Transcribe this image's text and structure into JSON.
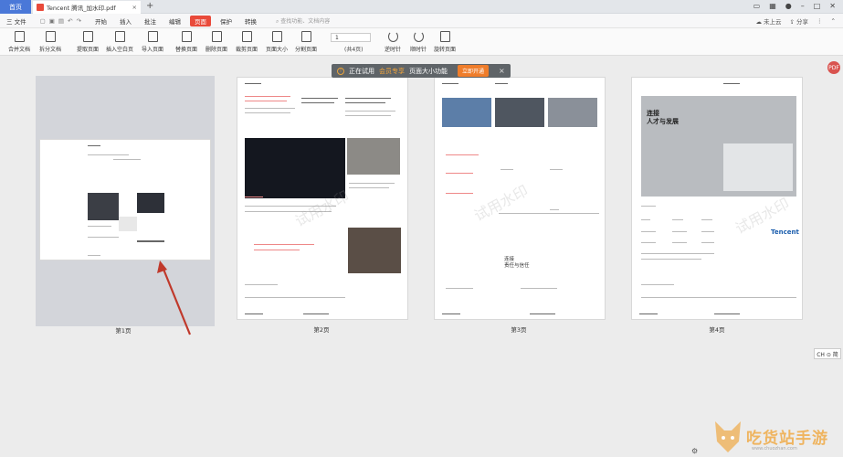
{
  "tabbar": {
    "home_label": "首页",
    "doc_title": "Tencent 腾讯_加水印.pdf",
    "close_glyph": "×",
    "new_tab_glyph": "+"
  },
  "menubar": {
    "file_label": "三 文件",
    "items": [
      "开始",
      "插入",
      "批注",
      "编辑",
      "页面",
      "保护",
      "转换"
    ],
    "active_item": "页面",
    "search_placeholder": "查找功能、文档内容",
    "cloud_label": "未上云",
    "share_label": "分享"
  },
  "ribbon": {
    "buttons": [
      "合并文档",
      "拆分文档",
      "提取页面",
      "插入空白页",
      "导入页面",
      "替换页面",
      "删除页面",
      "裁剪页面",
      "页面大小",
      "分割页面",
      "逆时针",
      "顺时针",
      "旋转页面"
    ],
    "page_input_value": "1",
    "page_total": "(共4页)"
  },
  "banner": {
    "prefix": "正在试用",
    "highlight": "会员专享",
    "suffix": "页面大小功能",
    "button_label": "立即开通",
    "close_glyph": "×"
  },
  "pages": [
    {
      "label": "第1页"
    },
    {
      "label": "第2页"
    },
    {
      "label": "第3页"
    },
    {
      "label": "第4页"
    }
  ],
  "thumbs": {
    "watermark": "试用水印",
    "p3_title1": "连接",
    "p3_title2": "责任与信任",
    "p4_title1": "连接",
    "p4_title2": "人才与发展",
    "p4_brand": "Tencent"
  },
  "side": {
    "right_badge": "PDF",
    "ime_label": "CH ⊙ 简"
  },
  "overlay_watermark": {
    "text": "吃货站手游",
    "url": "www.chuozhan.com"
  },
  "colors": {
    "accent": "#e94a3a",
    "home_tab": "#4a78d8",
    "banner_bg": "#5f6468",
    "banner_button": "#ef7d2b",
    "arrow": "#c0392b"
  }
}
